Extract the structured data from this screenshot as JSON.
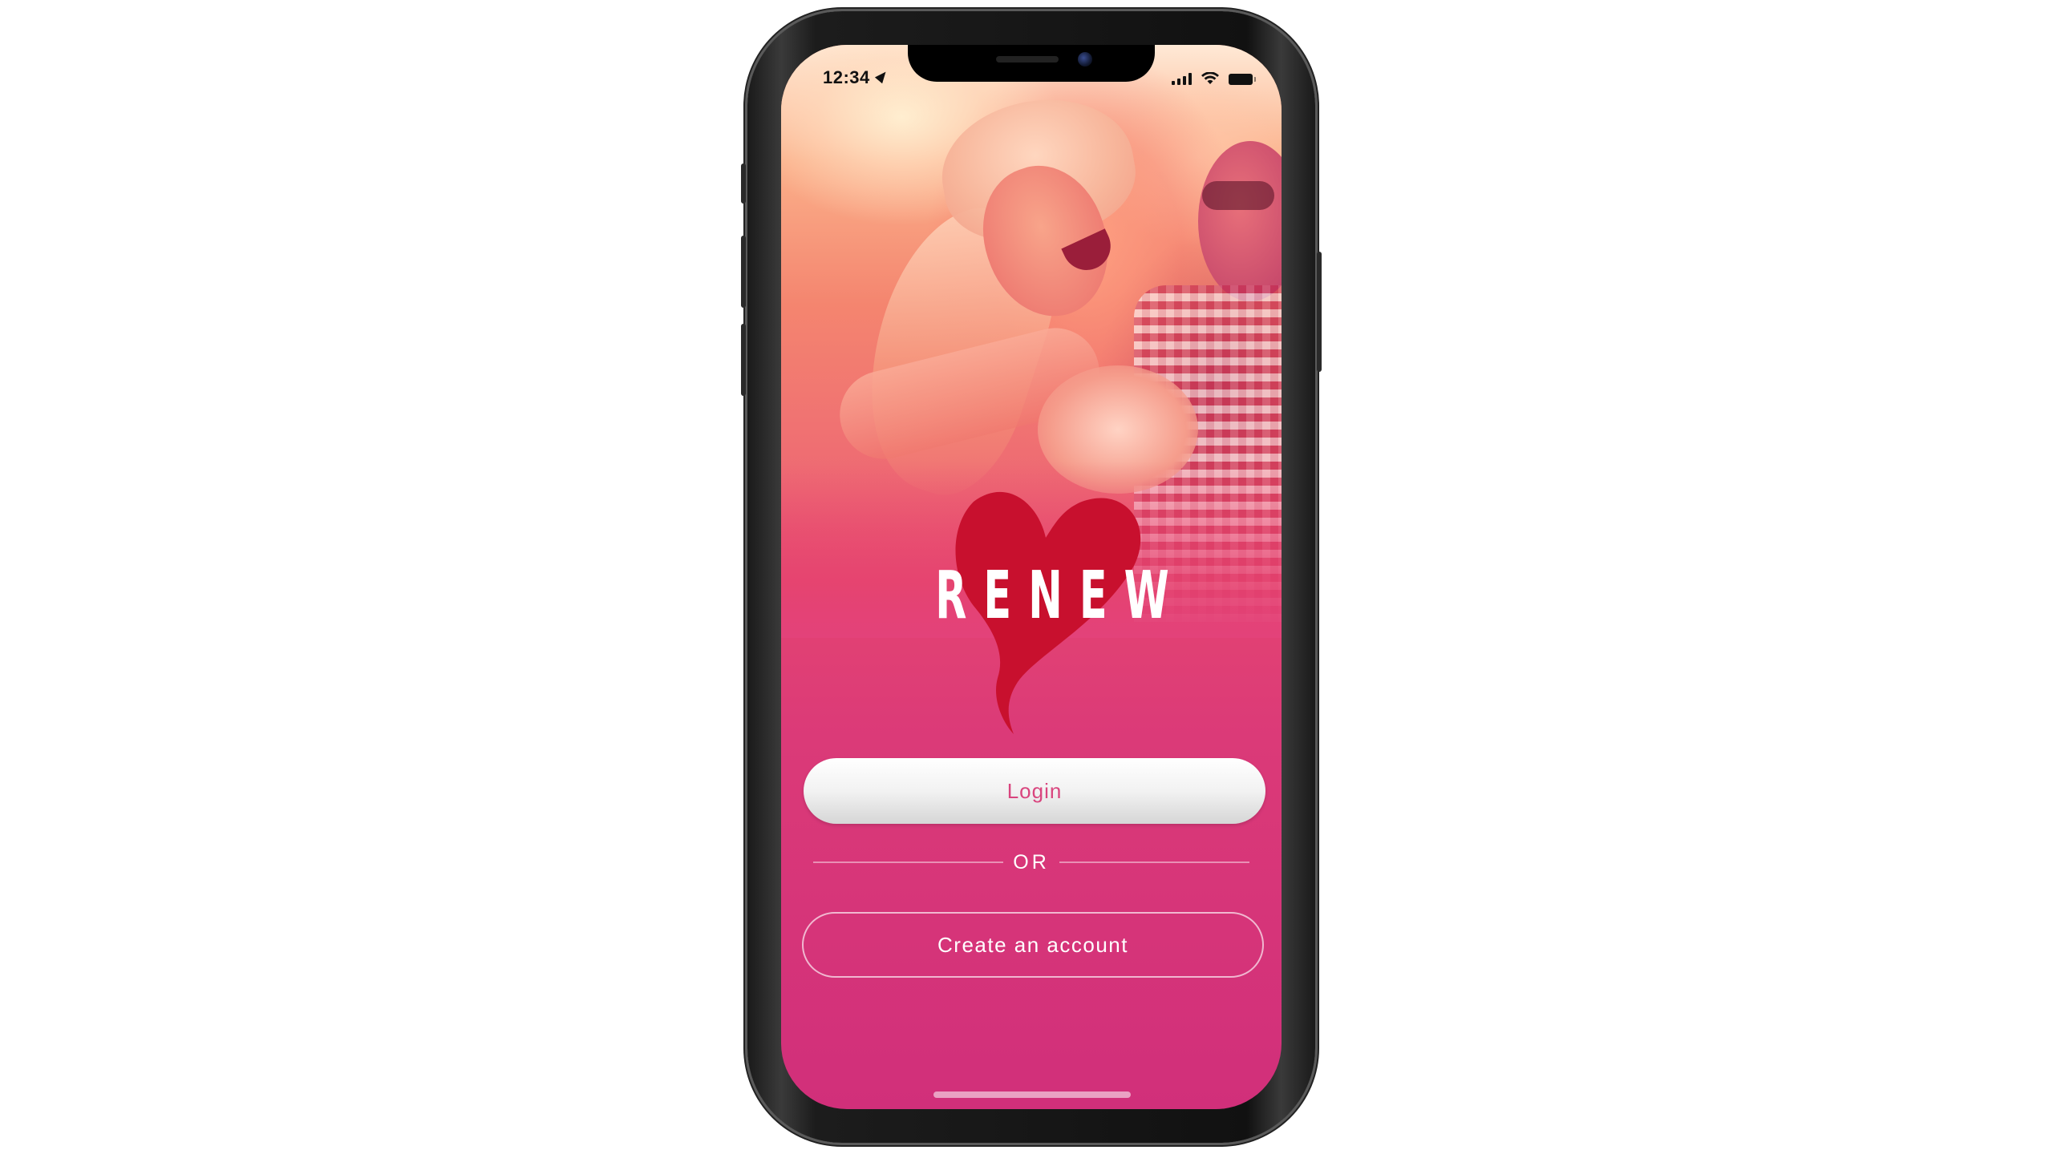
{
  "status_bar": {
    "time": "12:34",
    "icons": [
      "location-arrow-icon",
      "cellular-signal-icon",
      "wifi-icon",
      "battery-icon"
    ]
  },
  "app": {
    "logo_text": "RENEW",
    "logo_mark": "heart-icon",
    "brand_colors": {
      "heart": "#c8102e",
      "gradient_top": "#f6886a",
      "gradient_bottom": "#d12f7a",
      "login_text": "#d9457e"
    }
  },
  "actions": {
    "login_label": "Login",
    "separator_label": "OR",
    "create_account_label": "Create an account"
  }
}
